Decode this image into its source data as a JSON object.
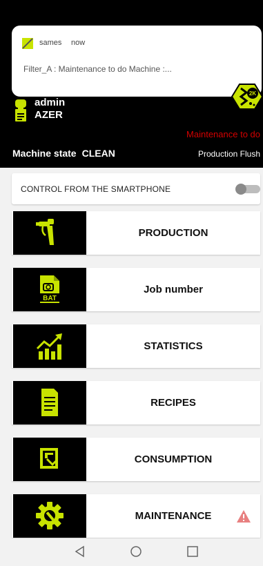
{
  "notification": {
    "app_name": "sames",
    "time": "now",
    "message": "Filter_A : Maintenance to do Machine :..."
  },
  "header": {
    "user": "admin",
    "project": "AZER",
    "maintenance_alert": "Maintenance to do",
    "machine_state_label": "Machine state",
    "machine_state_value": "CLEAN",
    "mode": "Production Flush"
  },
  "control": {
    "label": "CONTROL FROM THE SMARTPHONE",
    "enabled": false
  },
  "menu": {
    "items": [
      {
        "label": "PRODUCTION",
        "icon": "spray-gun-icon"
      },
      {
        "label": "Job number",
        "icon": "bat-document-icon"
      },
      {
        "label": "STATISTICS",
        "icon": "chart-up-icon"
      },
      {
        "label": "RECIPES",
        "icon": "document-icon"
      },
      {
        "label": "CONSUMPTION",
        "icon": "consumption-icon"
      },
      {
        "label": "MAINTENANCE",
        "icon": "gear-wrench-icon",
        "warning": true
      }
    ]
  },
  "colors": {
    "accent": "#c8e300",
    "header_bg": "#000000",
    "alert": "#d40000"
  }
}
